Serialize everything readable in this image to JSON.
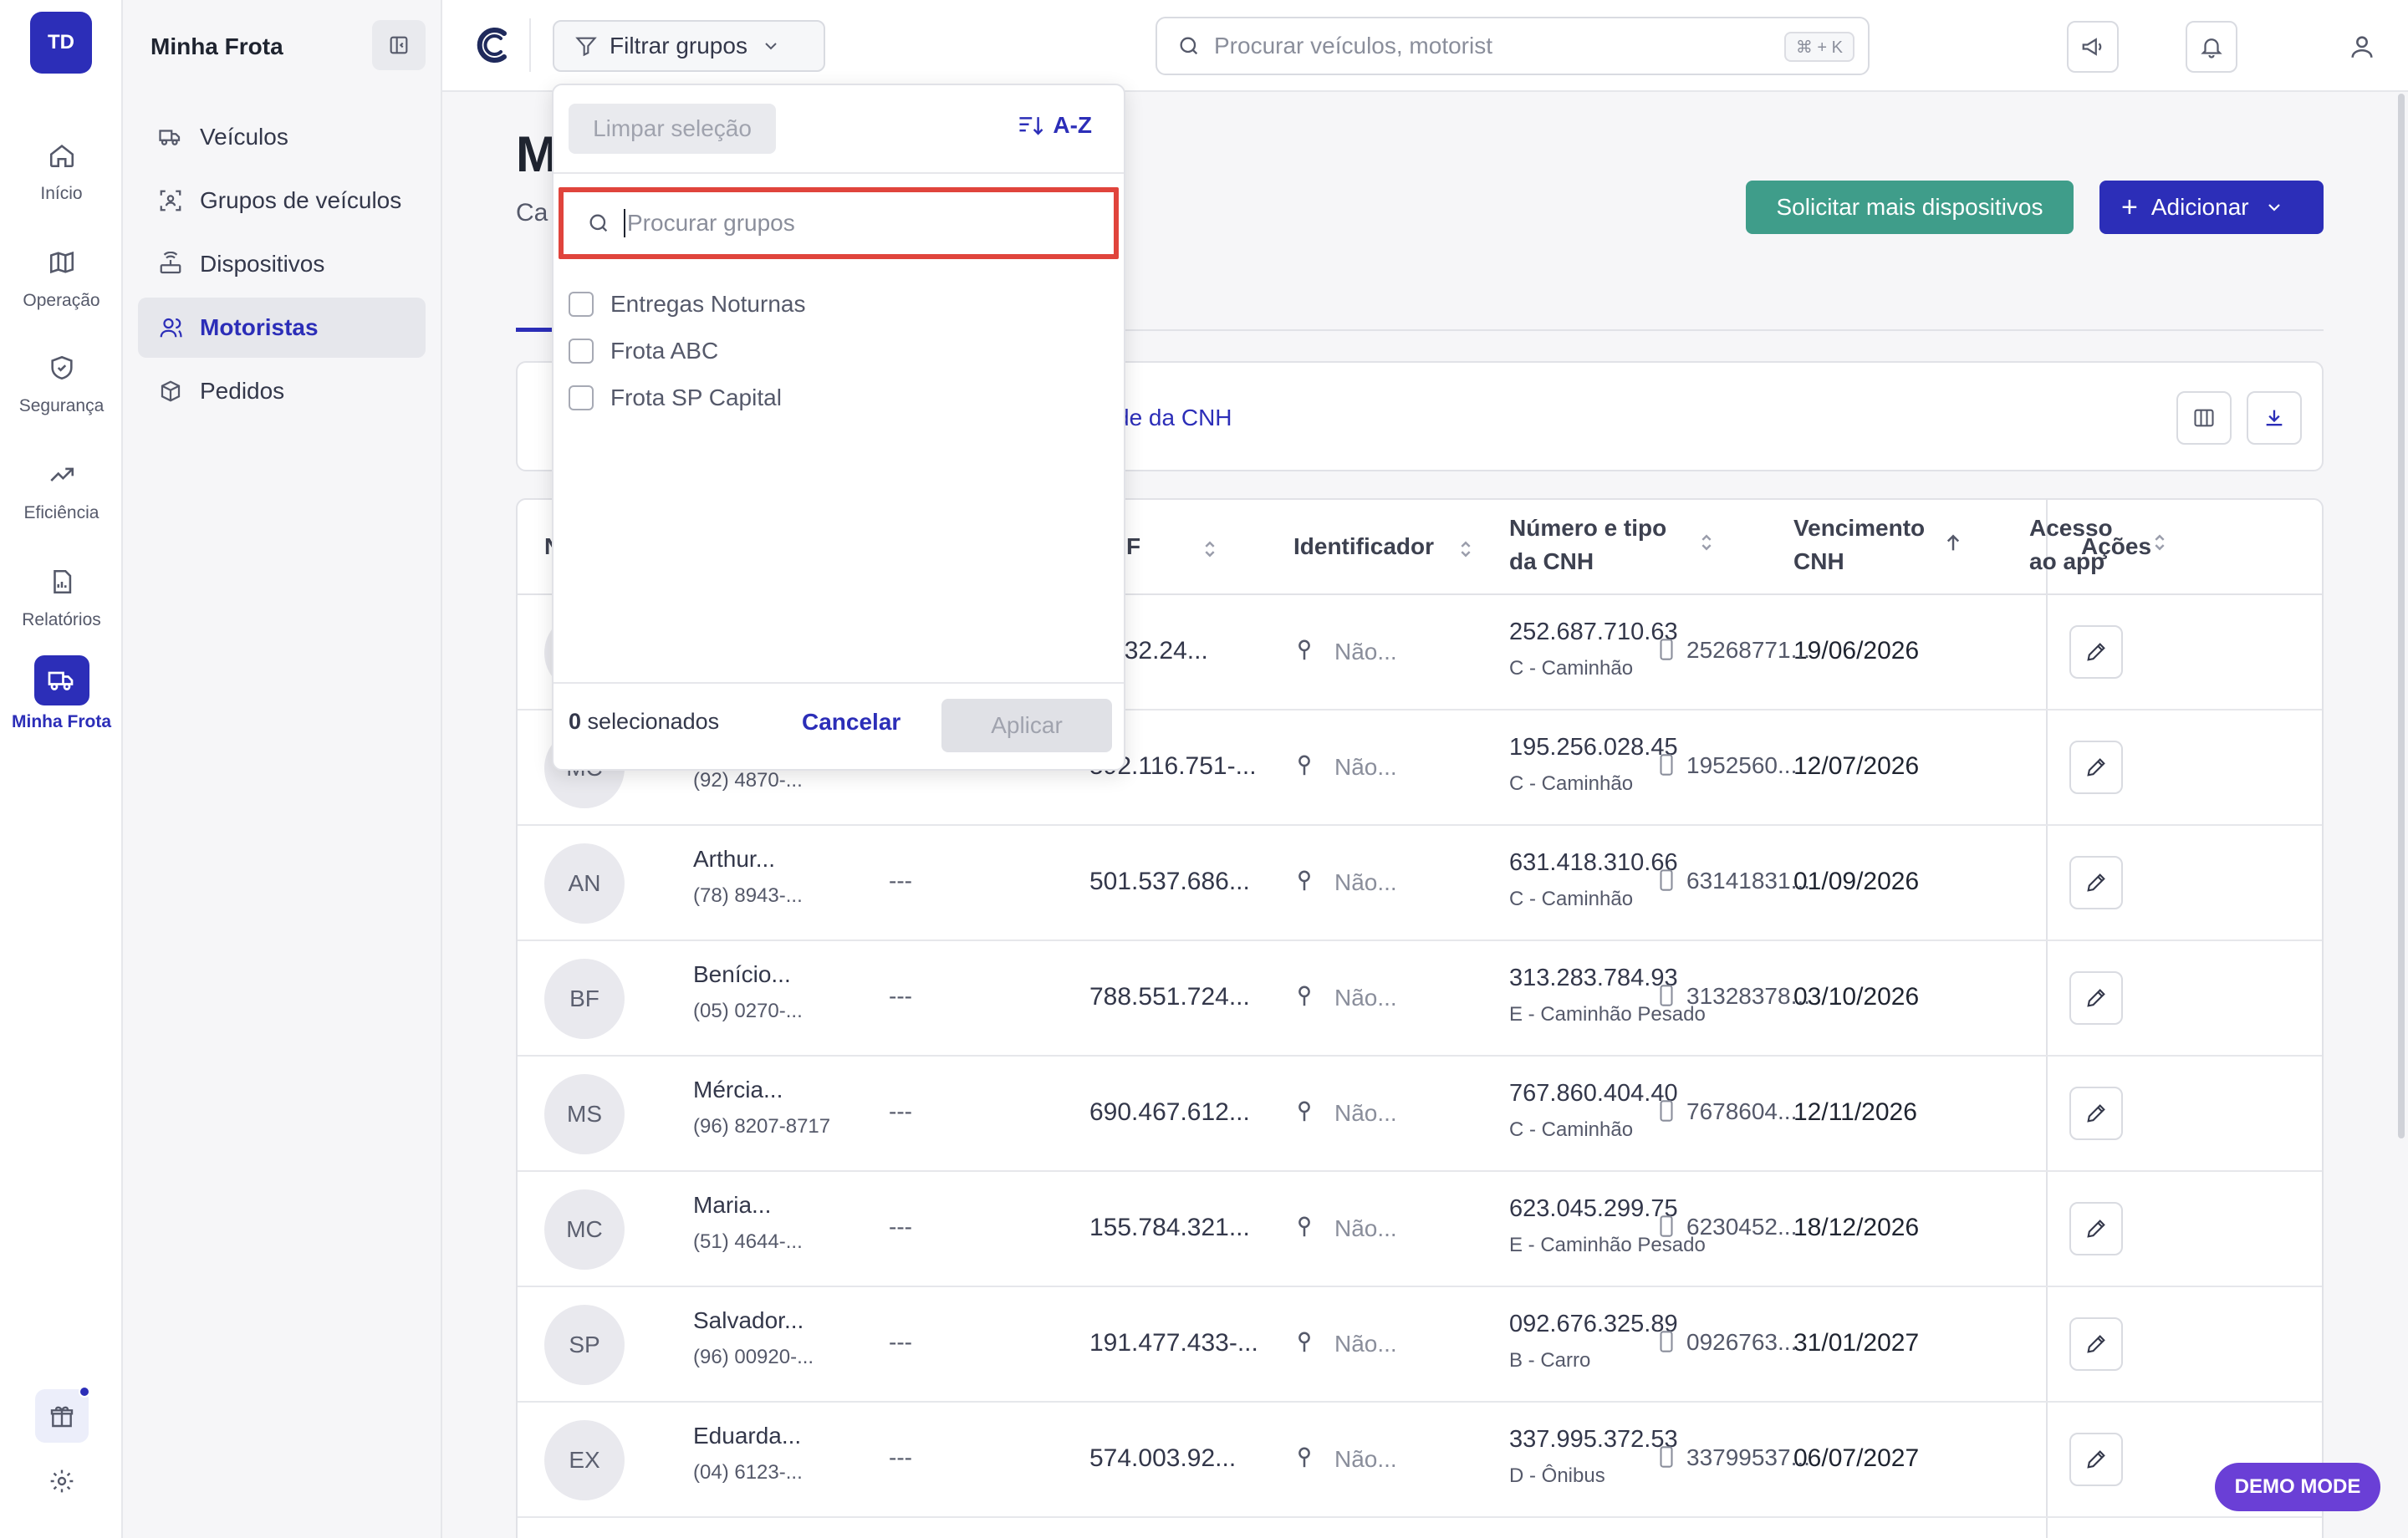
{
  "rail": {
    "avatar_initials": "TD",
    "items": [
      {
        "label": "Início",
        "icon": "home-icon"
      },
      {
        "label": "Operação",
        "icon": "map-icon"
      },
      {
        "label": "Segurança",
        "icon": "shield-icon"
      },
      {
        "label": "Eficiência",
        "icon": "trend-icon"
      },
      {
        "label": "Relatórios",
        "icon": "report-icon"
      },
      {
        "label": "Minha Frota",
        "icon": "truck-icon",
        "active": true
      }
    ]
  },
  "sidebar": {
    "title": "Minha Frota",
    "items": [
      {
        "label": "Veículos",
        "icon": "truck-icon"
      },
      {
        "label": "Grupos de veículos",
        "icon": "group-icon"
      },
      {
        "label": "Dispositivos",
        "icon": "router-icon"
      },
      {
        "label": "Motoristas",
        "icon": "user-icon",
        "active": true
      },
      {
        "label": "Pedidos",
        "icon": "box-icon"
      }
    ]
  },
  "topbar": {
    "filter_label": "Filtrar grupos",
    "search_placeholder": "Procurar veículos, motorist",
    "search_shortcut": "⌘ + K"
  },
  "main": {
    "title_partial": "M",
    "subtitle_partial": "Ca",
    "btn_more_devices": "Solicitar mais dispositivos",
    "btn_add": "Adicionar",
    "toolbar_link_partial": "de da CNH"
  },
  "table": {
    "headers": {
      "name_partial": "N",
      "cpf_partial": "F",
      "identifier": "Identificador",
      "cnh": "Número e tipo da CNH",
      "due": "Vencimento CNH",
      "app": "Acesso ao app",
      "actions": "Ações"
    },
    "rows": [
      {
        "initials": "",
        "name": "",
        "phone": "",
        "dash": "",
        "cpf": "2.232.24...",
        "ident": "Não...",
        "cnh": "252.687.710.63",
        "cnh_type": "C - Caminhão",
        "due": "19/06/2026",
        "app": "25268771..."
      },
      {
        "initials": "MC",
        "name": "",
        "phone": "(92) 4870-...",
        "dash": "",
        "cpf": "592.116.751-...",
        "ident": "Não...",
        "cnh": "195.256.028.45",
        "cnh_type": "C - Caminhão",
        "due": "12/07/2026",
        "app": "1952560..."
      },
      {
        "initials": "AN",
        "name": "Arthur...",
        "phone": "(78) 8943-...",
        "dash": "---",
        "cpf": "501.537.686...",
        "ident": "Não...",
        "cnh": "631.418.310.66",
        "cnh_type": "C - Caminhão",
        "due": "01/09/2026",
        "app": "63141831..."
      },
      {
        "initials": "BF",
        "name": "Benício...",
        "phone": "(05) 0270-...",
        "dash": "---",
        "cpf": "788.551.724...",
        "ident": "Não...",
        "cnh": "313.283.784.93",
        "cnh_type": "E - Caminhão Pesado",
        "due": "03/10/2026",
        "app": "31328378..."
      },
      {
        "initials": "MS",
        "name": "Mércia...",
        "phone": "(96) 8207-8717",
        "dash": "---",
        "cpf": "690.467.612...",
        "ident": "Não...",
        "cnh": "767.860.404.40",
        "cnh_type": "C - Caminhão",
        "due": "12/11/2026",
        "app": "7678604..."
      },
      {
        "initials": "MC",
        "name": "Maria...",
        "phone": "(51) 4644-...",
        "dash": "---",
        "cpf": "155.784.321...",
        "ident": "Não...",
        "cnh": "623.045.299.75",
        "cnh_type": "E - Caminhão Pesado",
        "due": "18/12/2026",
        "app": "6230452..."
      },
      {
        "initials": "SP",
        "name": "Salvador...",
        "phone": "(96) 00920-...",
        "dash": "---",
        "cpf": "191.477.433-...",
        "ident": "Não...",
        "cnh": "092.676.325.89",
        "cnh_type": "B - Carro",
        "due": "31/01/2027",
        "app": "0926763..."
      },
      {
        "initials": "EX",
        "name": "Eduarda...",
        "phone": "(04) 6123-...",
        "dash": "---",
        "cpf": "574.003.92...",
        "ident": "Não...",
        "cnh": "337.995.372.53",
        "cnh_type": "D - Ônibus",
        "due": "06/07/2027",
        "app": "33799537..."
      }
    ]
  },
  "dropdown": {
    "clear_label": "Limpar seleção",
    "sort_label": "A-Z",
    "search_placeholder": "Procurar grupos",
    "options": [
      "Entregas Noturnas",
      "Frota ABC",
      "Frota SP Capital"
    ],
    "count": "0",
    "count_suffix": "selecionados",
    "cancel_label": "Cancelar",
    "apply_label": "Aplicar"
  },
  "demo_badge": "DEMO MODE",
  "colors": {
    "primary": "#2c2eb8",
    "teal": "#3f9d8a",
    "highlight": "#e0443c",
    "demo": "#6a3fd6"
  }
}
